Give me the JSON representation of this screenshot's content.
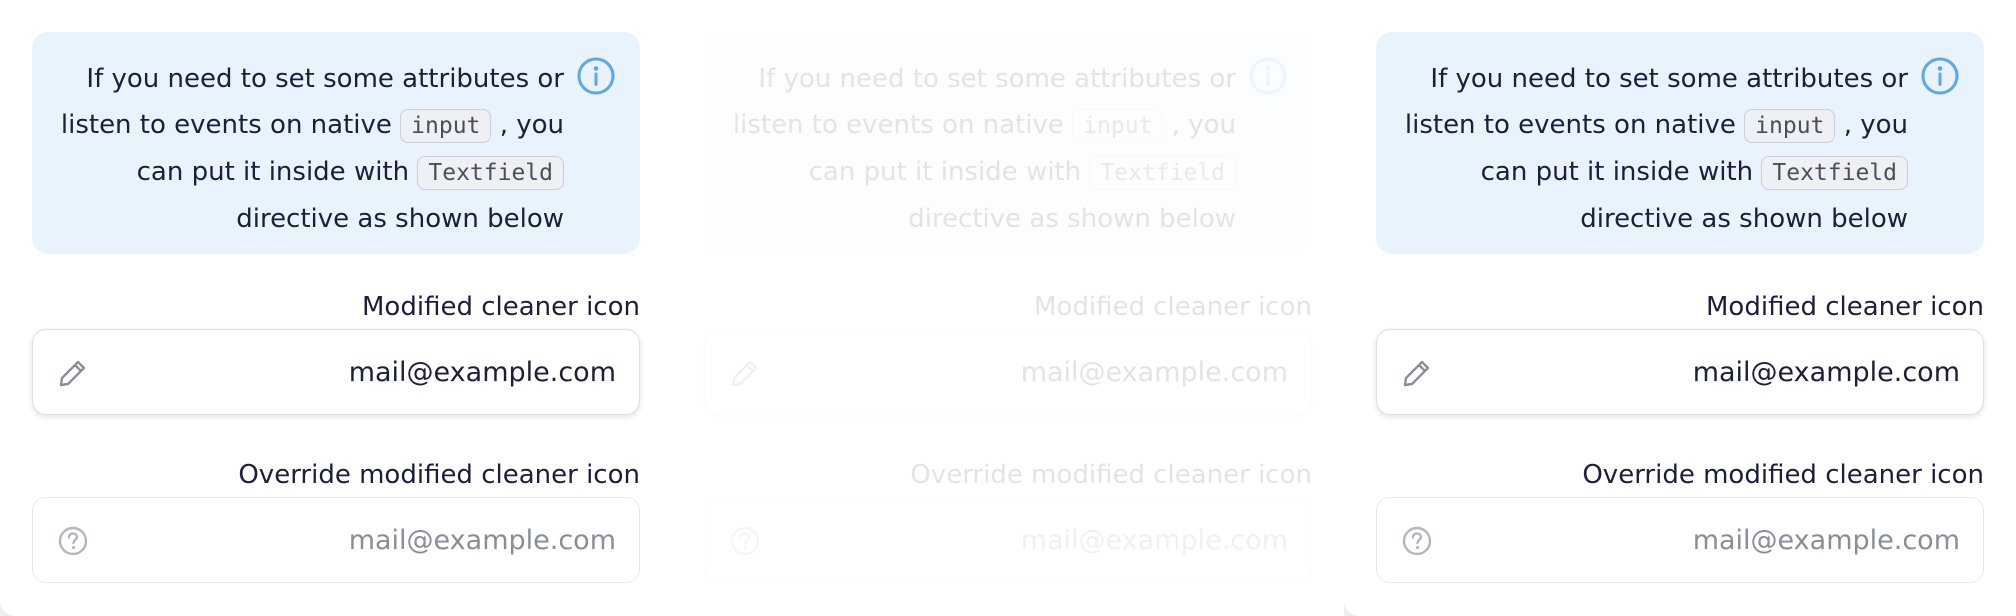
{
  "notice": {
    "line1": "If you need to set some attributes or",
    "line2_pre": "listen to events on native",
    "code_input": "input",
    "line2_post": ", you",
    "line3_pre": "can put it inside with",
    "code_textfield": "Textfield",
    "line4": "directive as shown below"
  },
  "fields": {
    "modified": {
      "label": "Modified cleaner icon",
      "value": "mail@example.com"
    },
    "override": {
      "label": "Override modified cleaner icon",
      "value": "mail@example.com"
    }
  },
  "colors": {
    "info_icon": "#5aa9ec",
    "field_icon": "#8a8e99",
    "notice_bg": "#e9f3fd"
  },
  "icons": {
    "info": "info-circle-icon",
    "edit": "pencil-icon",
    "help": "question-circle-icon"
  }
}
